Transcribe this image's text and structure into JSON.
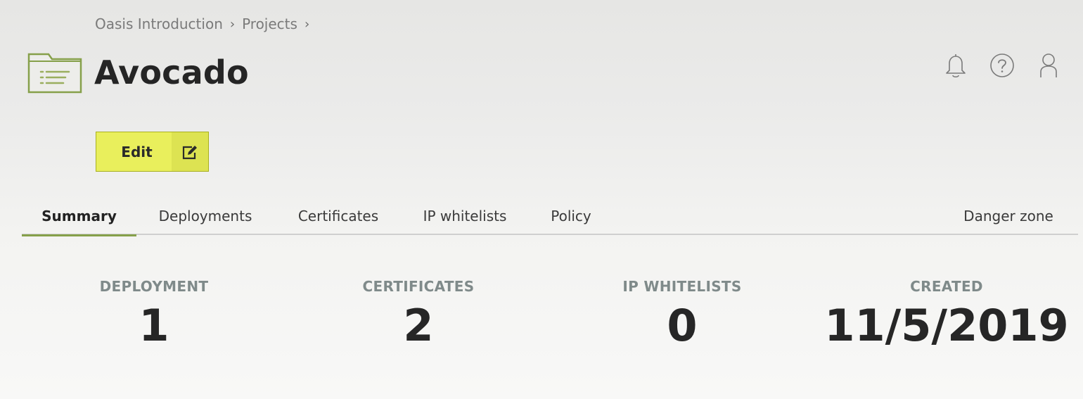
{
  "breadcrumb": {
    "items": [
      "Oasis Introduction",
      "Projects"
    ],
    "separator": "›"
  },
  "header": {
    "title": "Avocado",
    "icons": [
      "folder-icon",
      "bell-icon",
      "help-icon",
      "user-icon"
    ]
  },
  "edit_button": {
    "label": "Edit",
    "icon": "edit-icon"
  },
  "tabs": [
    {
      "label": "Summary",
      "active": true
    },
    {
      "label": "Deployments",
      "active": false
    },
    {
      "label": "Certificates",
      "active": false
    },
    {
      "label": "IP whitelists",
      "active": false
    },
    {
      "label": "Policy",
      "active": false
    },
    {
      "label": "Danger zone",
      "active": false
    }
  ],
  "stats": [
    {
      "label": "DEPLOYMENT",
      "value": "1"
    },
    {
      "label": "CERTIFICATES",
      "value": "2"
    },
    {
      "label": "IP WHITELISTS",
      "value": "0"
    },
    {
      "label": "CREATED",
      "value": "11/5/2019"
    }
  ],
  "colors": {
    "accent_green": "#86a04a",
    "button_yellow": "#e9ef5c",
    "stat_label": "#7f8a8a"
  }
}
